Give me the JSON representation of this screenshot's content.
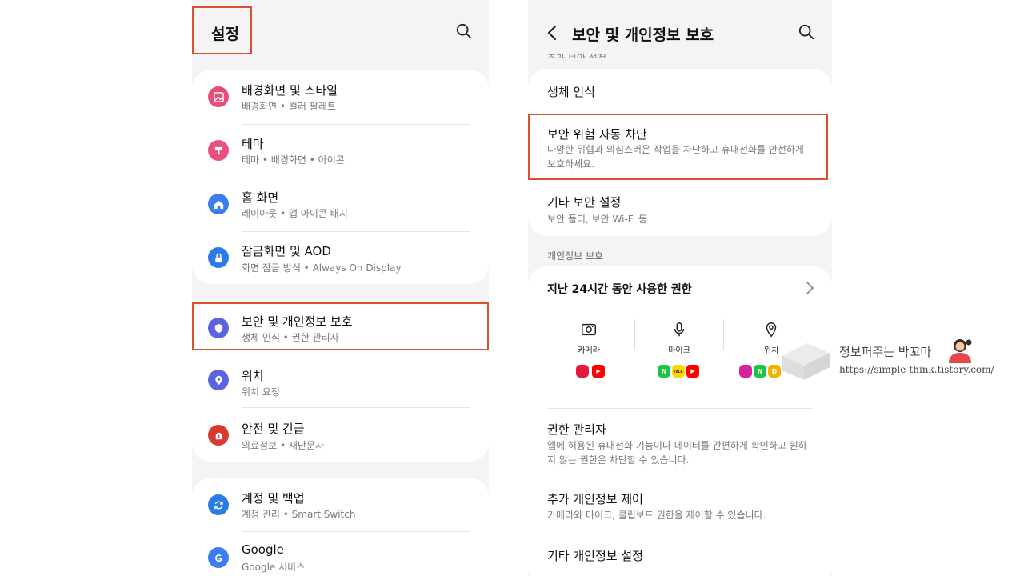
{
  "left": {
    "title": "설정",
    "groups": [
      [
        {
          "title": "배경화면 및 스타일",
          "sub": "배경화면 • 컬러 팔레트",
          "icon": "wallpaper-icon",
          "color": "#e84d7a"
        },
        {
          "title": "테마",
          "sub": "테마 • 배경화면 • 아이콘",
          "icon": "theme-icon",
          "color": "#e8507d"
        },
        {
          "title": "홈 화면",
          "sub": "레이아웃 • 앱 아이콘 배지",
          "icon": "home-icon",
          "color": "#3b7cf0"
        },
        {
          "title": "잠금화면 및 AOD",
          "sub": "화면 잠금 방식 • Always On Display",
          "icon": "lock-icon",
          "color": "#2a7ae8"
        }
      ],
      [
        {
          "title": "보안 및 개인정보 보호",
          "sub": "생체 인식 • 권한 관리자",
          "icon": "shield-icon",
          "color": "#5b63e0"
        },
        {
          "title": "위치",
          "sub": "위치 요청",
          "icon": "location-icon",
          "color": "#5b63e0"
        },
        {
          "title": "안전 및 긴급",
          "sub": "의료정보 • 재난문자",
          "icon": "emergency-icon",
          "color": "#d9392e"
        }
      ],
      [
        {
          "title": "계정 및 백업",
          "sub": "계정 관리 • Smart Switch",
          "icon": "sync-icon",
          "color": "#2a7ae8"
        },
        {
          "title": "Google",
          "sub": "Google 서비스",
          "icon": "google-icon",
          "color": "#3b7cf0"
        }
      ]
    ]
  },
  "right": {
    "title": "보안 및 개인정보 보호",
    "cut_label": "추가 보안 설정",
    "security": [
      {
        "title": "생체 인식",
        "sub": ""
      },
      {
        "title": "보안 위험 자동 차단",
        "sub": "다양한 위협과 의심스러운 작업을 차단하고 휴대전화를 안전하게 보호하세요."
      },
      {
        "title": "기타 보안 설정",
        "sub": "보안 폴더, 보안 Wi-Fi 등"
      }
    ],
    "privacy_label": "개인정보 보호",
    "recent_title": "지난 24시간 동안 사용한 권한",
    "permissions": [
      {
        "label": "카메라",
        "icon": "camera-icon"
      },
      {
        "label": "마이크",
        "icon": "mic-icon"
      },
      {
        "label": "위치",
        "icon": "location-pin-icon"
      }
    ],
    "apps": {
      "camera": [
        {
          "letter": "",
          "color": "#e5193c"
        },
        {
          "letter": "▶",
          "color": "#ff0000"
        }
      ],
      "mic": [
        {
          "letter": "N",
          "color": "#19c440"
        },
        {
          "letter": "TALK",
          "color": "#f7d800"
        },
        {
          "letter": "▶",
          "color": "#ff0000"
        }
      ],
      "location": [
        {
          "letter": "",
          "color": "#d6249f"
        },
        {
          "letter": "N",
          "color": "#19c440"
        },
        {
          "letter": "D",
          "color": "#f0b400"
        }
      ]
    },
    "privacy": [
      {
        "title": "권한 관리자",
        "sub": "앱에 허용된 휴대전화 기능이나 데이터를 간편하게 확인하고 원하지 않는 권한은 차단할 수 있습니다."
      },
      {
        "title": "추가 개인정보 제어",
        "sub": "카메라와 마이크, 클립보드 권한을 제어할 수 있습니다."
      },
      {
        "title": "기타 개인정보 설정",
        "sub": ""
      }
    ]
  },
  "watermark": {
    "name": "정보퍼주는 박꼬마",
    "url": "https://simple-think.tistory.com/"
  }
}
